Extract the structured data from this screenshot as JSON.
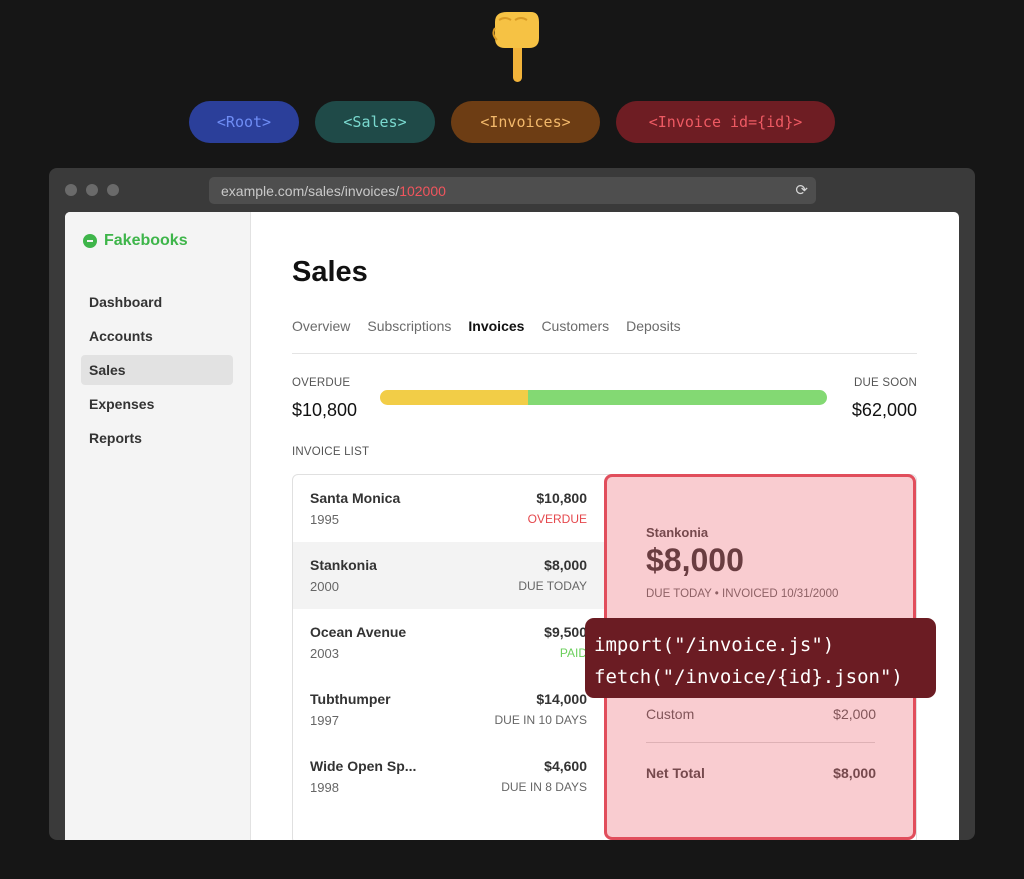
{
  "routes": [
    "<Root>",
    "<Sales>",
    "<Invoices>",
    "<Invoice id={id}>"
  ],
  "colors": {
    "root": "#2b3f9a",
    "sales": "#1f4a48",
    "invoices": "#6d3d14",
    "invoice": "#6e1d23",
    "brand": "#3eb54a",
    "overdue_bar": "#f2cd47",
    "due_soon_bar": "#83d973",
    "overdue_text": "#e5484d",
    "paid_text": "#6bcf5c"
  },
  "browser": {
    "url_base": "example.com/sales/invoices/",
    "url_id": "102000"
  },
  "sidebar": {
    "brand": "Fakebooks",
    "items": [
      {
        "label": "Dashboard"
      },
      {
        "label": "Accounts"
      },
      {
        "label": "Sales"
      },
      {
        "label": "Expenses"
      },
      {
        "label": "Reports"
      }
    ],
    "active": "Sales"
  },
  "main": {
    "title": "Sales",
    "tabs": [
      {
        "label": "Overview"
      },
      {
        "label": "Subscriptions"
      },
      {
        "label": "Invoices"
      },
      {
        "label": "Customers"
      },
      {
        "label": "Deposits"
      }
    ],
    "active_tab": "Invoices"
  },
  "summary": {
    "overdue_label": "OVERDUE",
    "overdue_amount": "$10,800",
    "due_soon_label": "DUE SOON",
    "due_soon_amount": "$62,000",
    "overdue_fraction": 0.33
  },
  "invoice_list": {
    "heading": "INVOICE LIST",
    "rows": [
      {
        "name": "Santa Monica",
        "year": "1995",
        "amount": "$10,800",
        "status": "OVERDUE"
      },
      {
        "name": "Stankonia",
        "year": "2000",
        "amount": "$8,000",
        "status": "DUE TODAY"
      },
      {
        "name": "Ocean Avenue",
        "year": "2003",
        "amount": "$9,500",
        "status": "PAID"
      },
      {
        "name": "Tubthumper",
        "year": "1997",
        "amount": "$14,000",
        "status": "DUE IN 10 DAYS"
      },
      {
        "name": "Wide Open Sp...",
        "year": "1998",
        "amount": "$4,600",
        "status": "DUE IN 8 DAYS"
      }
    ],
    "active_row": 1
  },
  "detail": {
    "name": "Stankonia",
    "amount": "$8,000",
    "meta": "DUE TODAY • INVOICED 10/31/2000",
    "line_label": "Custom",
    "line_amount": "$2,000",
    "total_label": "Net Total",
    "total_amount": "$8,000"
  },
  "callout": {
    "line1": "import(\"/invoice.js\")",
    "line2": "fetch(\"/invoice/{id}.json\")"
  }
}
